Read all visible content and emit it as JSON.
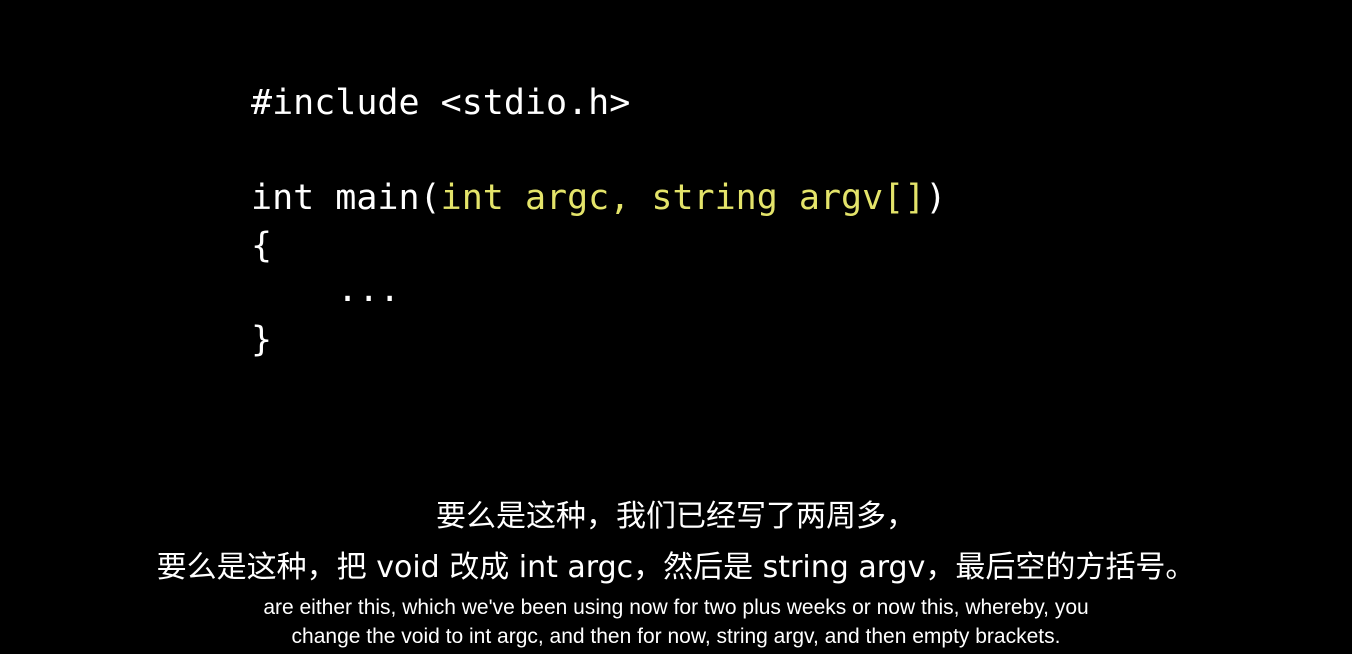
{
  "code": {
    "include": "#include <stdio.h>",
    "sig_prefix": "int main(",
    "sig_params": "int argc, string argv[]",
    "sig_suffix": ")",
    "open_brace": "{",
    "body": "...",
    "close_brace": "}"
  },
  "colors": {
    "background": "#000000",
    "code_text": "#ffffff",
    "highlight": "#e4e46a"
  },
  "subtitles": {
    "zh_line1": "要么是这种，我们已经写了两周多，",
    "zh_line2": "要么是这种，把 void 改成 int argc，然后是 string argv，最后空的方括号。",
    "en_line1": "are either this, which we've been using now for two plus weeks or now this, whereby, you",
    "en_line2": "change the void to int argc, and then for now, string argv, and then empty brackets."
  }
}
